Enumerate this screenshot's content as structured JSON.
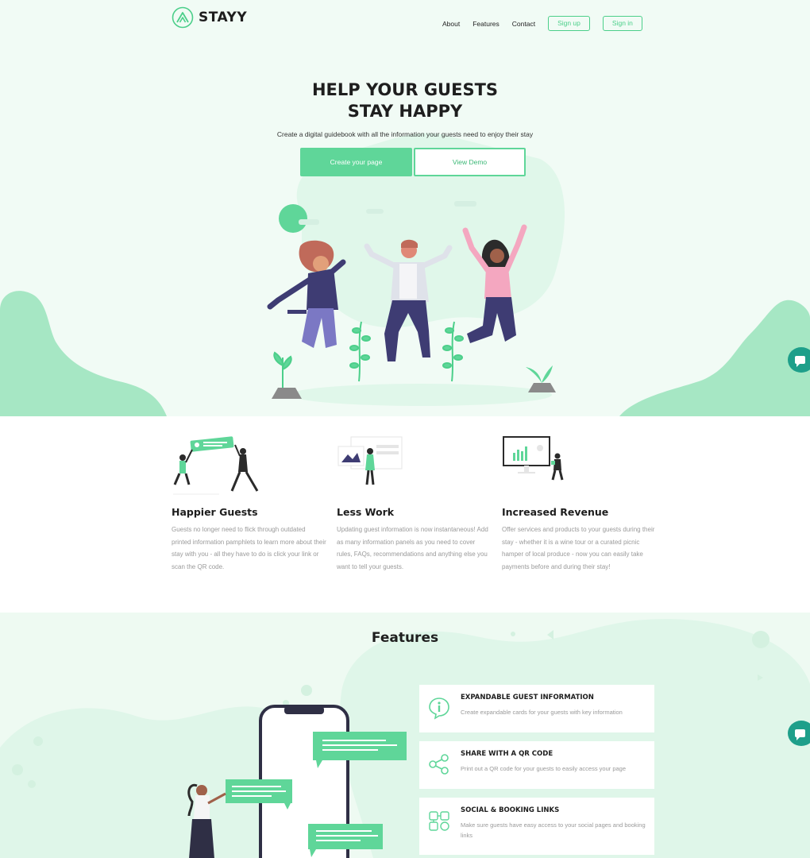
{
  "brand": {
    "name": "STAYY",
    "accent": "#5fd699",
    "accent_dark": "#3db877"
  },
  "nav": {
    "about": "About",
    "features": "Features",
    "contact": "Contact",
    "signup": "Sign up",
    "signin": "Sign in"
  },
  "hero": {
    "title_line1": "HELP YOUR GUESTS",
    "title_line2": "STAY HAPPY",
    "subtitle": "Create a digital guidebook with all the information your guests need to enjoy their stay",
    "primary_cta": "Create your page",
    "secondary_cta": "View Demo"
  },
  "benefits": [
    {
      "title": "Happier Guests",
      "text": "Guests no longer need to flick through outdated printed information pamphlets to learn more about their stay with you - all they have to do is click your link or scan the QR code."
    },
    {
      "title": "Less Work",
      "text": "Updating guest information is now instantaneous! Add as many information panels as you need to cover rules, FAQs, recommendations and anything else you want to tell your guests."
    },
    {
      "title": "Increased Revenue",
      "text": "Offer services and products to your guests during their stay - whether it is a wine tour or a curated picnic hamper of local produce - now you can easily take payments before and during their stay!"
    }
  ],
  "features": {
    "title": "Features",
    "items": [
      {
        "title": "EXPANDABLE GUEST INFORMATION",
        "text": "Create expandable cards for your guests with key information",
        "icon": "info-icon"
      },
      {
        "title": "SHARE WITH A QR CODE",
        "text": "Print out a QR code for your guests to easily access your page",
        "icon": "share-icon"
      },
      {
        "title": "SOCIAL & BOOKING LINKS",
        "text": "Make sure guests have easy access to your social pages and booking links",
        "icon": "social-links-icon"
      }
    ]
  }
}
